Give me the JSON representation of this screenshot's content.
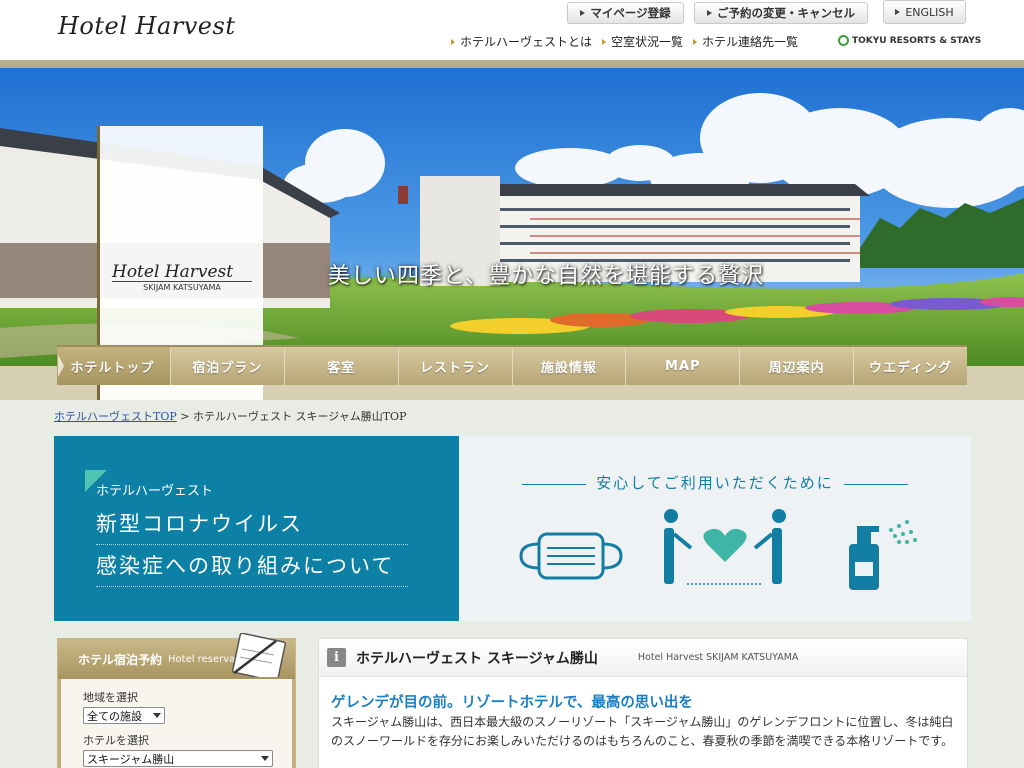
{
  "header": {
    "logo": "Hotel Harvest",
    "buttons": {
      "mypage": "マイページ登録",
      "reservation_change": "ご予約の変更・キャンセル",
      "english": "ENGLISH"
    },
    "links": [
      "ホテルハーヴェストとは",
      "空室状況一覧",
      "ホテル連絡先一覧"
    ],
    "tokyu": "TOKYU RESORTS & STAYS"
  },
  "hero": {
    "logo_name": "Hotel Harvest",
    "logo_sub": "SKIJAM KATSUYAMA",
    "slogan": "美しい四季と、豊かな自然を堪能する贅沢"
  },
  "nav": [
    "ホテルトップ",
    "宿泊プラン",
    "客室",
    "レストラン",
    "施設情報",
    "MAP",
    "周辺案内",
    "ウエディング"
  ],
  "breadcrumb": {
    "home": "ホテルハーヴェストTOP",
    "separator": ">",
    "current": "ホテルハーヴェスト スキージャム勝山TOP"
  },
  "banner": {
    "hotel": "ホテルハーヴェスト",
    "line1": "新型コロナウイルス",
    "line2": "感染症への取り組みについて",
    "caption": "安心してご利用いただくために"
  },
  "reservation": {
    "title": "ホテル宿泊予約",
    "title_en": "Hotel reservation",
    "area_label": "地域を選択",
    "area_value": "全ての施設",
    "hotel_label": "ホテルを選択",
    "hotel_value": "スキージャム勝山"
  },
  "info": {
    "icon": "i",
    "title": "ホテルハーヴェスト スキージャム勝山",
    "subtitle": "Hotel Harvest SKIJAM KATSUYAMA",
    "lead": "ゲレンデが目の前。リゾートホテルで、最高の思い出を",
    "body": "スキージャム勝山は、西日本最大級のスノーリゾート「スキージャム勝山」のゲレンデフロントに位置し、冬は純白のスノーワールドを存分にお楽しみいただけるのはもちろんのこと、春夏秋の季節を満喫できる本格リゾートです。"
  },
  "colors": {
    "gold": "#b7a676",
    "teal": "#0d80a6",
    "link_blue": "#1a7ec3"
  }
}
